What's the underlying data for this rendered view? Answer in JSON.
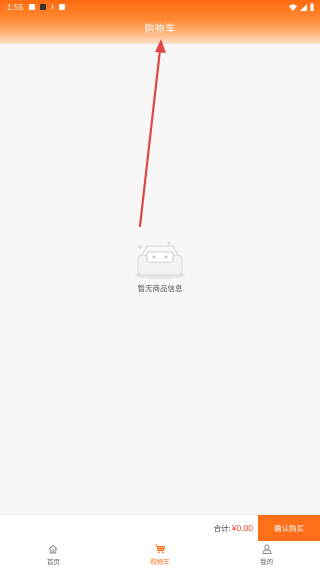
{
  "status_bar": {
    "time": "1:55"
  },
  "header": {
    "title": "购物车"
  },
  "empty_state": {
    "message": "暂无商品信息",
    "icon": "empty-box-icon"
  },
  "checkout": {
    "total_label": "合计:",
    "total_value": "¥0.00",
    "confirm_label": "确认购买"
  },
  "tabbar": {
    "items": [
      {
        "label": "首页",
        "icon": "home-icon",
        "active": false
      },
      {
        "label": "购物车",
        "icon": "cart-icon",
        "active": true
      },
      {
        "label": "我的",
        "icon": "user-icon",
        "active": false
      }
    ]
  },
  "colors": {
    "accent": "#ff6f1a",
    "price": "#ff3b1f",
    "annotation_arrow": "#e04848"
  }
}
